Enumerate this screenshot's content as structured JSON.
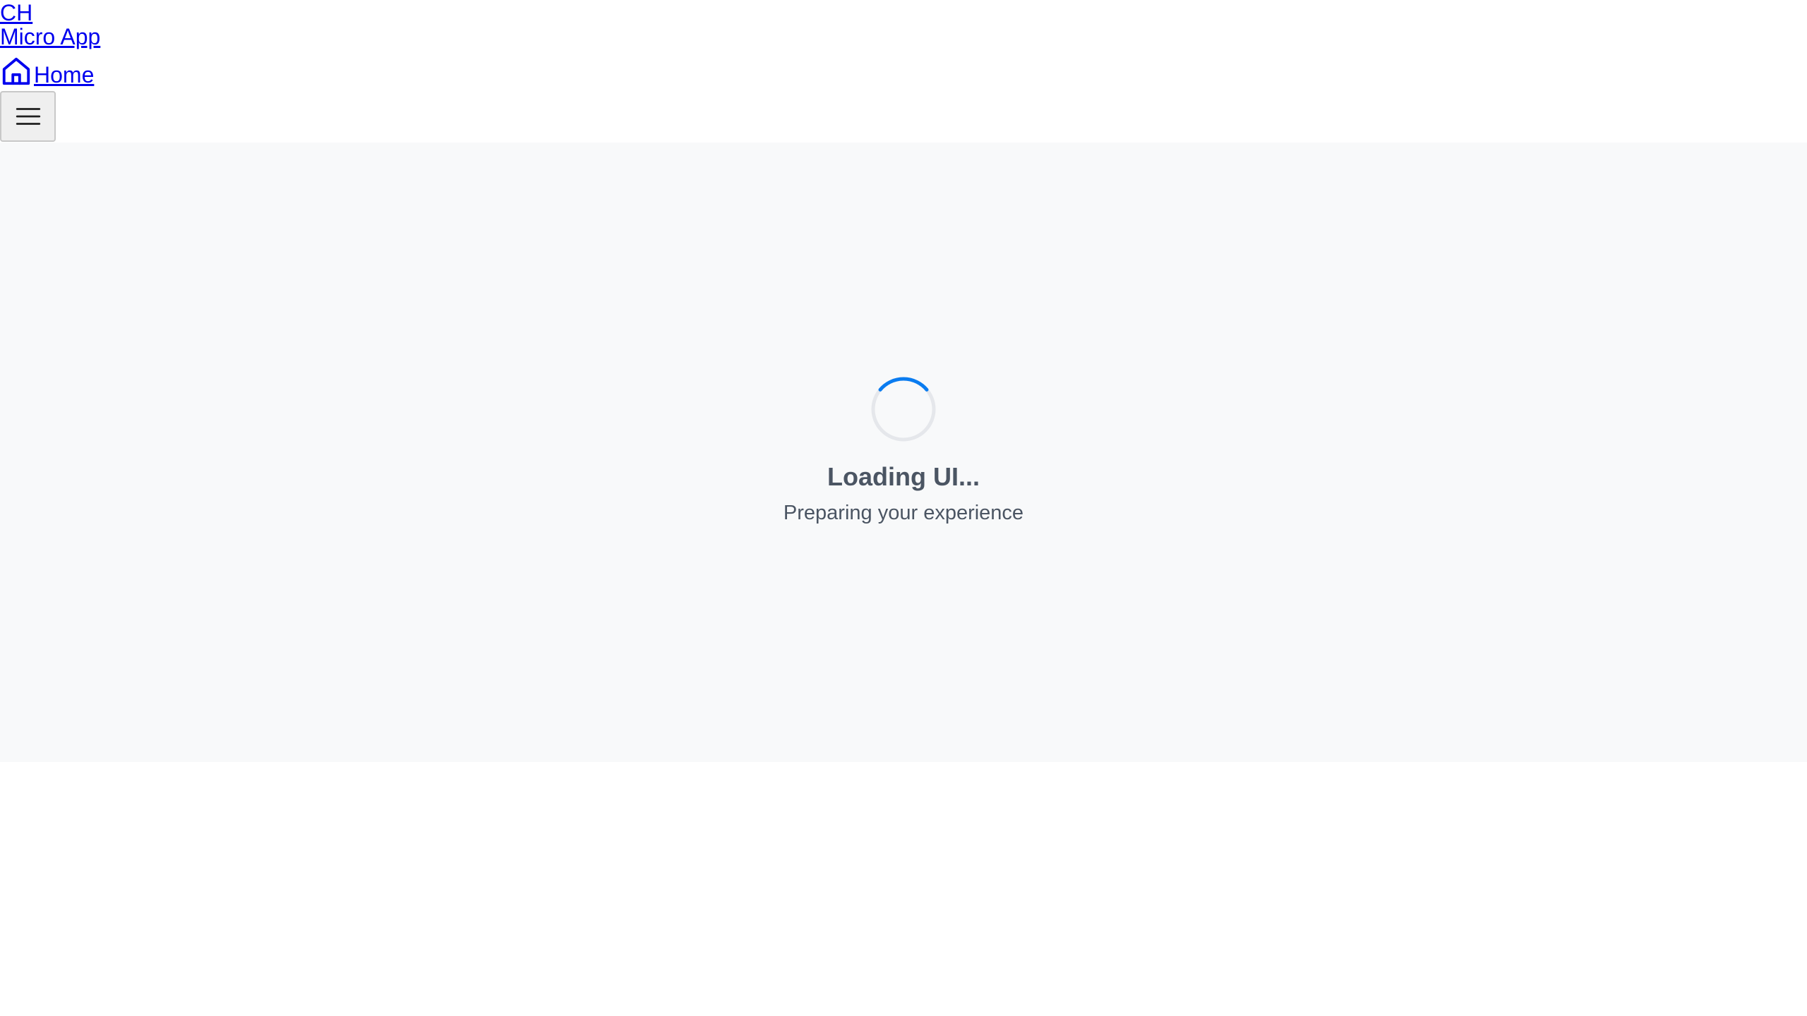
{
  "header": {
    "brand_abbr": "CH",
    "brand_name": "Micro App",
    "home_label": "Home",
    "home_icon": "home-icon",
    "menu_icon": "hamburger-menu-icon"
  },
  "main": {
    "loading_title": "Loading UI...",
    "loading_subtitle": "Preparing your experience",
    "spinner_icon": "loading-spinner-icon"
  },
  "colors": {
    "link": "#0000ee",
    "main_background": "#f8f9fa",
    "spinner_accent": "#0a7cf0",
    "spinner_track": "#e5e7eb",
    "text_muted": "#4b5563"
  }
}
